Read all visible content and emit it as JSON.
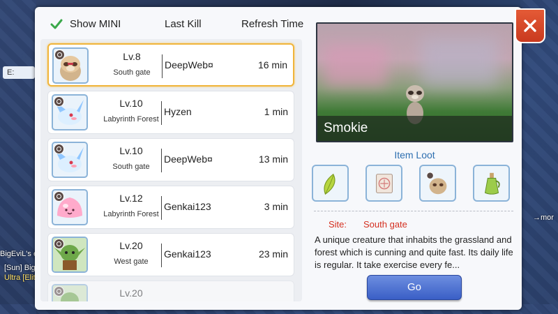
{
  "background": {
    "chat_lines": [
      "BigEviL's e",
      "[Sun] Big",
      "Ultra [Elit",
      "→mor"
    ],
    "chip_label": "E:"
  },
  "header": {
    "show_mini_label": "Show MINI",
    "show_mini_checked": true,
    "last_kill_label": "Last Kill",
    "refresh_time_label": "Refresh Time"
  },
  "list": {
    "rows": [
      {
        "level": "Lv.8",
        "map": "South gate",
        "killer": "DeepWeb¤",
        "time": "16 min",
        "selected": true,
        "monster_icon": "smokie-icon"
      },
      {
        "level": "Lv.10",
        "map": "Labyrinth Forest",
        "killer": "Hyzen",
        "time": "1 min",
        "selected": false,
        "monster_icon": "lunatic-icon"
      },
      {
        "level": "Lv.10",
        "map": "South gate",
        "killer": "DeepWeb¤",
        "time": "13 min",
        "selected": false,
        "monster_icon": "lunatic-icon"
      },
      {
        "level": "Lv.12",
        "map": "Labyrinth Forest",
        "killer": "Genkai123",
        "time": "3 min",
        "selected": false,
        "monster_icon": "poring-icon"
      },
      {
        "level": "Lv.20",
        "map": "West gate",
        "killer": "Genkai123",
        "time": "23 min",
        "selected": false,
        "monster_icon": "goblin-icon"
      },
      {
        "level": "Lv.20",
        "map": "",
        "killer": "",
        "time": "",
        "selected": false,
        "monster_icon": "goblin-icon"
      }
    ]
  },
  "detail": {
    "monster_name": "Smokie",
    "item_loot_label": "Item Loot",
    "loot_items": [
      "leaf-icon",
      "scroll-icon",
      "smokie-card-icon",
      "potion-bottle-icon"
    ],
    "site_label": "Site:",
    "site_value": "South gate",
    "description": "A unique creature that inhabits the grassland and forest which is cunning and quite fast. Its daily life is regular. It take exercise every fe...",
    "go_label": "Go"
  },
  "colors": {
    "accent_blue": "#2e6fb0",
    "site_red": "#d42f1f",
    "selected_border": "#f0b43a",
    "close_red": "#d9472a"
  }
}
